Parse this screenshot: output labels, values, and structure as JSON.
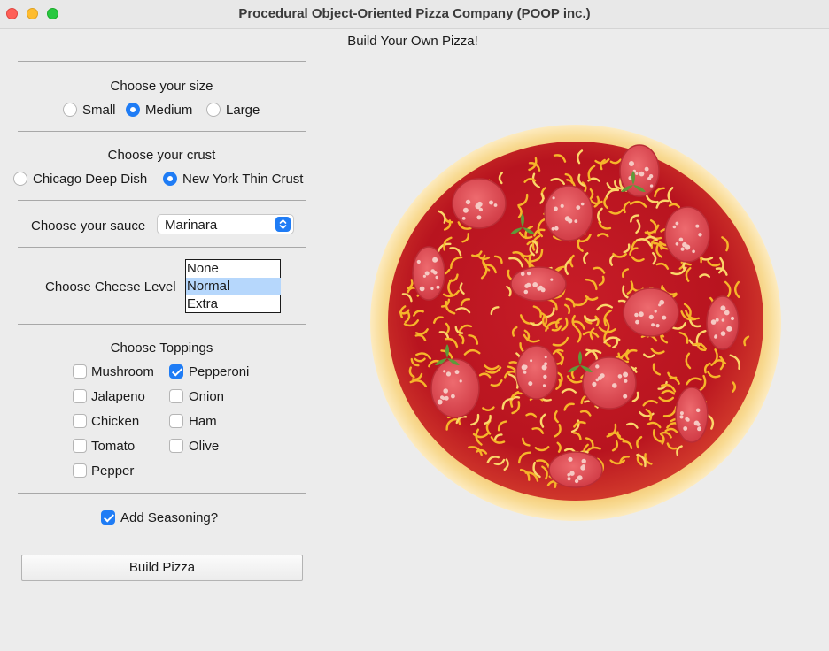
{
  "window": {
    "title": "Procedural Object-Oriented Pizza Company (POOP inc.)",
    "controls": [
      "close",
      "minimize",
      "zoom"
    ]
  },
  "heading": "Build Your Own Pizza!",
  "size": {
    "label": "Choose your size",
    "options": [
      "Small",
      "Medium",
      "Large"
    ],
    "selected": "Medium"
  },
  "crust": {
    "label": "Choose your crust",
    "options": [
      "Chicago Deep Dish",
      "New York Thin Crust"
    ],
    "selected": "New York Thin Crust"
  },
  "sauce": {
    "label": "Choose your sauce",
    "value": "Marinara"
  },
  "cheese": {
    "label": "Choose Cheese Level",
    "options": [
      "None",
      "Normal",
      "Extra"
    ],
    "selected": "Normal"
  },
  "toppings": {
    "label": "Choose Toppings",
    "items": [
      {
        "label": "Mushroom",
        "checked": false
      },
      {
        "label": "Pepperoni",
        "checked": true
      },
      {
        "label": "Jalapeno",
        "checked": false
      },
      {
        "label": "Onion",
        "checked": false
      },
      {
        "label": "Chicken",
        "checked": false
      },
      {
        "label": "Ham",
        "checked": false
      },
      {
        "label": "Tomato",
        "checked": false
      },
      {
        "label": "Olive",
        "checked": false
      },
      {
        "label": "Pepper",
        "checked": false
      }
    ]
  },
  "seasoning": {
    "label": "Add Seasoning?",
    "checked": true
  },
  "build_button": "Build Pizza",
  "colors": {
    "accent": "#1f7cf5",
    "crust": "#f6d78a",
    "sauce": "#c4202a",
    "pepperoni": "#e0525a",
    "cheese": "#f6b52a",
    "basil": "#5e9a3a"
  }
}
